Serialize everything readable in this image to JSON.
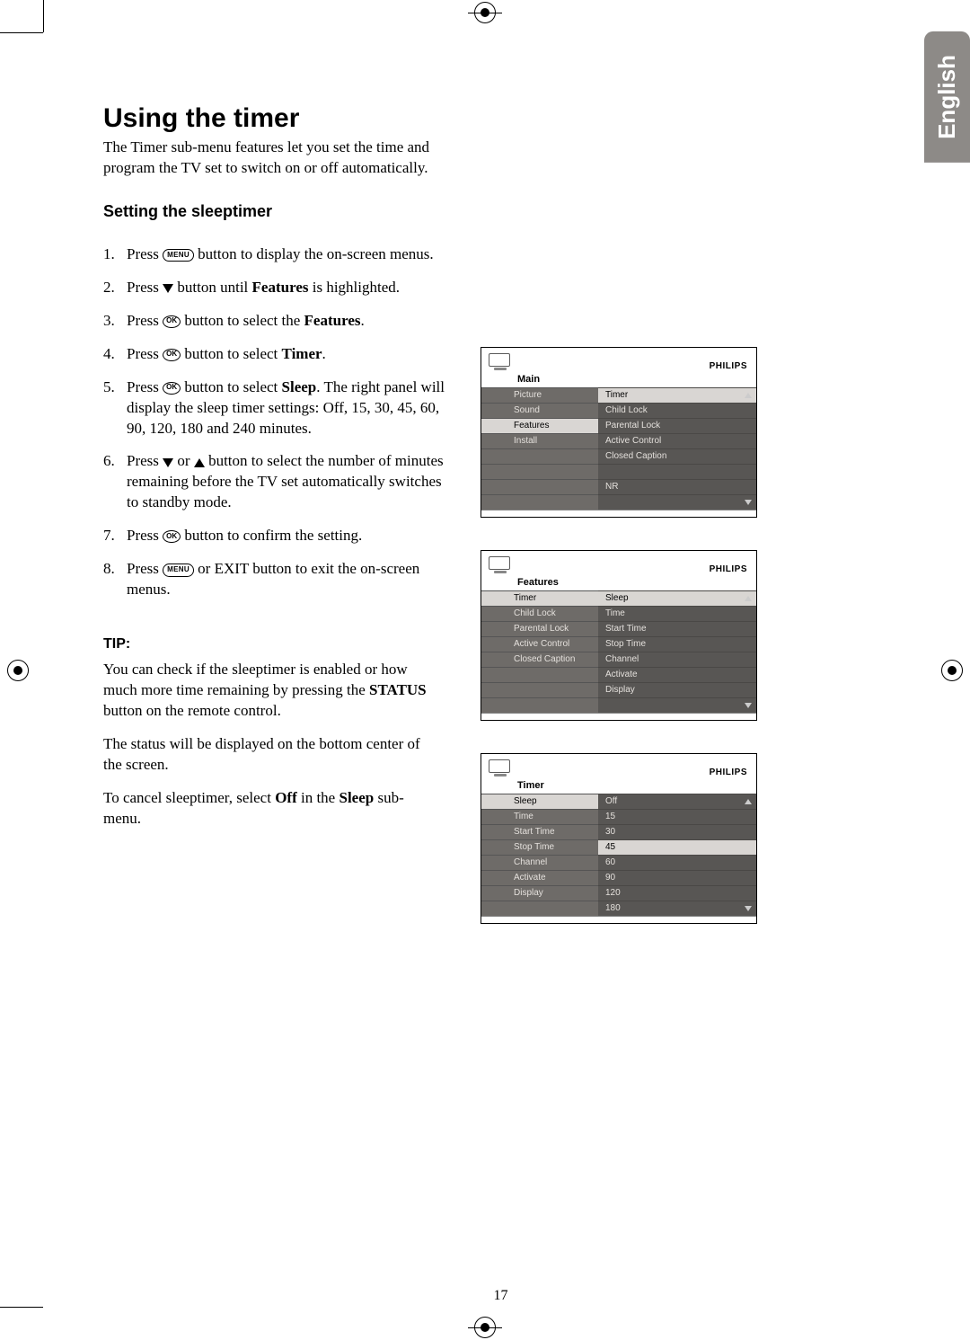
{
  "page_number": "17",
  "language_tab": "English",
  "heading": "Using the timer",
  "intro": "The Timer sub-menu features let you set the time and program the TV set to switch on or off automatically.",
  "subheading": "Setting the sleeptimer",
  "steps": {
    "s1a": "Press ",
    "s1b": " button to display the on-screen menus.",
    "s2a": "Press ",
    "s2b": " button until ",
    "s2c": "Features",
    "s2d": " is highlighted.",
    "s3a": "Press ",
    "s3b": " button to select the ",
    "s3c": "Features",
    "s3d": ".",
    "s4a": "Press ",
    "s4b": " button to select ",
    "s4c": "Timer",
    "s4d": ".",
    "s5a": "Press ",
    "s5b": " button to select ",
    "s5c": "Sleep",
    "s5d": ". The right panel will display the sleep timer settings: Off, 15, 30, 45, 60, 90, 120, 180 and 240 minutes.",
    "s6a": "Press ",
    "s6b": " or ",
    "s6c": " button to select the number of minutes remaining before the TV set automatically switches to standby mode.",
    "s7a": "Press ",
    "s7b": " button to confirm the setting.",
    "s8a": "Press ",
    "s8b": " or EXIT button to exit the on-screen menus."
  },
  "buttons": {
    "menu": "MENU",
    "ok": "OK"
  },
  "tip": {
    "label": "TIP:",
    "p1a": "You can check if the sleeptimer is enabled or how much more time remaining by pressing the ",
    "p1b": "STATUS",
    "p1c": " button on the remote control.",
    "p2": "The status will be displayed on the bottom center of the screen.",
    "p3a": "To cancel sleeptimer, select ",
    "p3b": "Off",
    "p3c": " in the ",
    "p3d": "Sleep",
    "p3e": " sub-menu."
  },
  "brand": "PHILIPS",
  "osd1": {
    "title": "Main",
    "left": [
      "Picture",
      "Sound",
      "Features",
      "Install",
      "",
      "",
      "",
      ""
    ],
    "right": [
      "Timer",
      "Child Lock",
      "Parental Lock",
      "Active Control",
      "Closed Caption",
      "",
      "NR",
      ""
    ],
    "hl_left_idx": 2,
    "hl_right_idx": 0
  },
  "osd2": {
    "title": "Features",
    "left": [
      "Timer",
      "Child Lock",
      "Parental Lock",
      "Active Control",
      "Closed Caption",
      "",
      "",
      ""
    ],
    "right": [
      "Sleep",
      "Time",
      "Start Time",
      "Stop Time",
      "Channel",
      "Activate",
      "Display",
      ""
    ],
    "hl_left_idx": 0,
    "hl_right_idx": 0
  },
  "osd3": {
    "title": "Timer",
    "left": [
      "Sleep",
      "Time",
      "Start Time",
      "Stop Time",
      "Channel",
      "Activate",
      "Display",
      ""
    ],
    "right": [
      "Off",
      "15",
      "30",
      "45",
      "60",
      "90",
      "120",
      "180"
    ],
    "hl_left_idx": 0,
    "hl_right_idx": 3
  }
}
